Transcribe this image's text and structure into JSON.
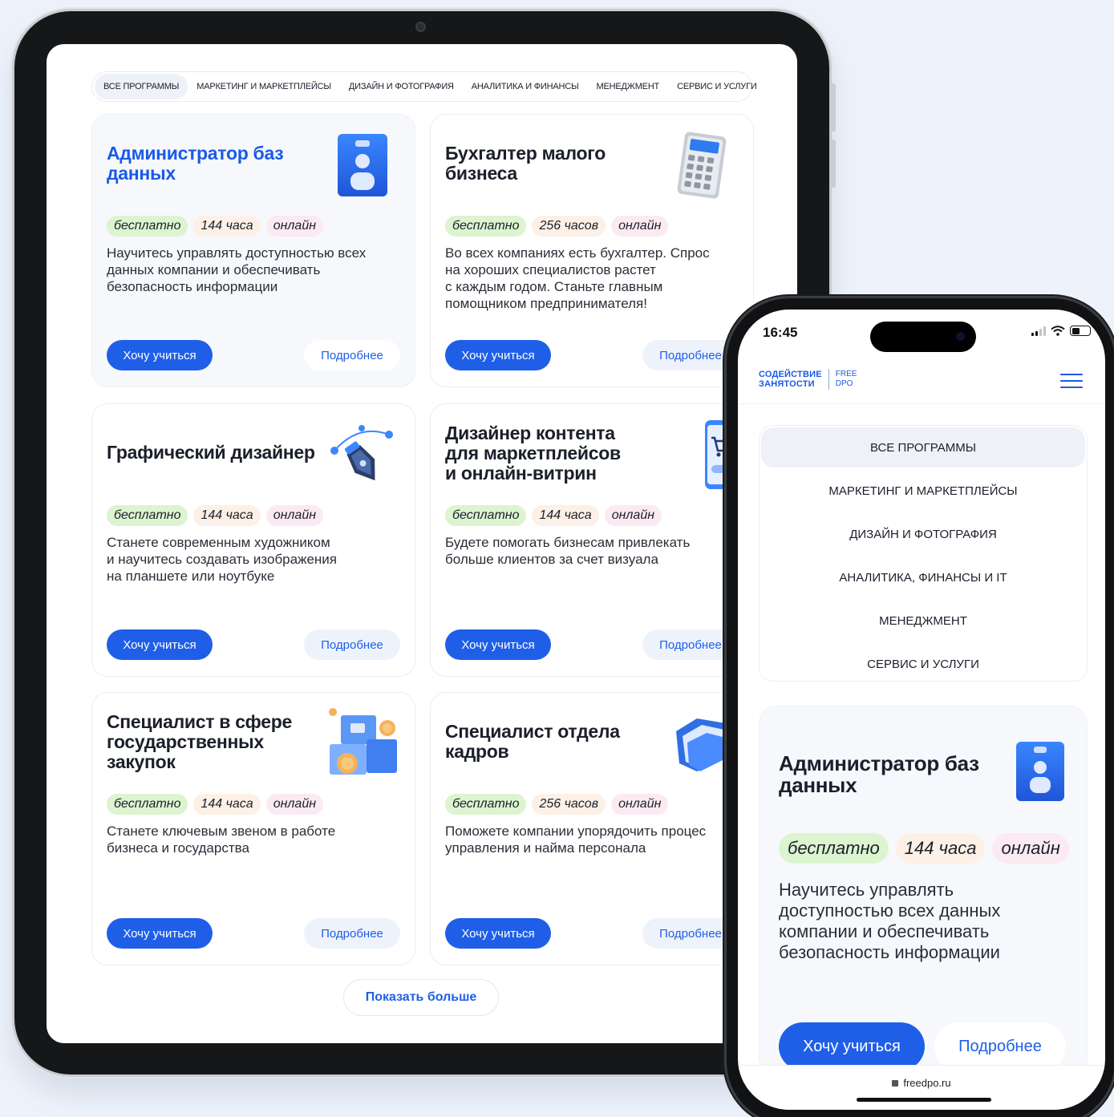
{
  "tablet": {
    "tabs": [
      {
        "label": "Все программы",
        "active": true
      },
      {
        "label": "Маркетинг и маркетплейсы"
      },
      {
        "label": "Дизайн и фотография"
      },
      {
        "label": "Аналитика и финансы"
      },
      {
        "label": "Менеджмент"
      },
      {
        "label": "Сервис и услуги"
      }
    ],
    "cards": [
      {
        "title": "Администратор баз\nданных",
        "chips": [
          "бесплатно",
          "144 часа",
          "онлайн"
        ],
        "desc": "Научитесь управлять доступностью всех\nданных компании и обеспечивать\nбезопасность информации",
        "primary": "Хочу учиться",
        "secondary": "Подробнее",
        "icon": "badge-icon"
      },
      {
        "title": "Бухгалтер малого\nбизнеса",
        "chips": [
          "бесплатно",
          "256 часов",
          "онлайн"
        ],
        "desc": "Во всех компаниях есть бухгалтер. Спрос\nна хороших специалистов растет\nс каждым годом. Станьте главным\nпомощником предпринимателя!",
        "primary": "Хочу учиться",
        "secondary": "Подробнее",
        "icon": "calculator-icon"
      },
      {
        "title": "Графический дизайнер",
        "chips": [
          "бесплатно",
          "144 часа",
          "онлайн"
        ],
        "desc": "Станете современным художником\nи научитесь создавать изображения\nна планшете или ноутбуке",
        "primary": "Хочу учиться",
        "secondary": "Подробнее",
        "icon": "pen-tool-icon"
      },
      {
        "title": "Дизайнер контента\nдля маркетплейсов\nи онлайн-витрин",
        "chips": [
          "бесплатно",
          "144 часа",
          "онлайн"
        ],
        "desc": "Будете помогать бизнесам привлекать\nбольше клиентов за счет визуала",
        "primary": "Хочу учиться",
        "secondary": "Подробнее",
        "icon": "shopping-phone-icon"
      },
      {
        "title": "Специалист в сфере\nгосударственных\nзакупок",
        "chips": [
          "бесплатно",
          "144 часа",
          "онлайн"
        ],
        "desc": "Станете ключевым звеном в работе\nбизнеса и государства",
        "primary": "Хочу учиться",
        "secondary": "Подробнее",
        "icon": "boxes-coins-icon"
      },
      {
        "title": "Специалист отдела\nкадров",
        "chips": [
          "бесплатно",
          "256 часов",
          "онлайн"
        ],
        "desc": "Поможете компании упорядочить процес\nуправления и найма персонала",
        "primary": "Хочу учиться",
        "secondary": "Подробнее",
        "icon": "folder-icon"
      }
    ],
    "show_more": "Показать больше"
  },
  "phone": {
    "time": "16:45",
    "logo_main": "СОДЕЙСТВИЕ\nЗАНЯТОСТИ",
    "logo_sub": "FREE\nDPO",
    "menu": [
      {
        "label": "Все программы",
        "active": true
      },
      {
        "label": "Маркетинг и маркетплейсы"
      },
      {
        "label": "Дизайн и фотография"
      },
      {
        "label": "Аналитика, финансы и IT"
      },
      {
        "label": "Менеджмент"
      },
      {
        "label": "Сервис и услуги"
      }
    ],
    "card": {
      "title": "Администратор баз\nданных",
      "chips": [
        "бесплатно",
        "144 часа",
        "онлайн"
      ],
      "desc": "Научитесь управлять\nдоступностью всех данных\nкомпании и обеспечивать\nбезопасность информации",
      "primary": "Хочу учиться",
      "secondary": "Подробнее"
    },
    "url": "freedpo.ru"
  },
  "colors": {
    "accent": "#1f5fe8",
    "chip_green": "#dcf4cf",
    "chip_peach": "#fdf0e6",
    "chip_pink": "#fbeaf1"
  }
}
